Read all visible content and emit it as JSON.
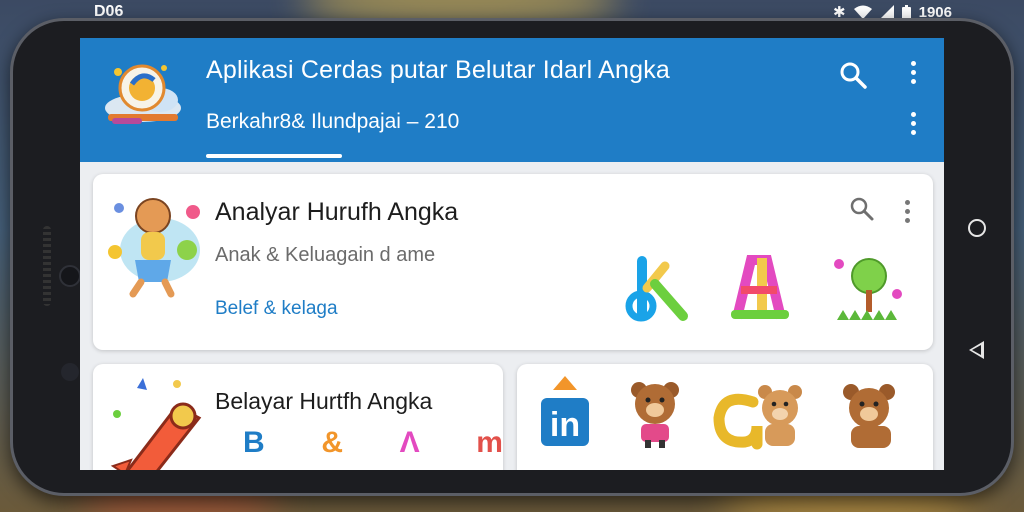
{
  "status_bar": {
    "left_text": "D06",
    "time": "1906",
    "icons": [
      "bluetooth-icon",
      "wifi-icon",
      "signal-icon",
      "battery-icon"
    ]
  },
  "app": {
    "title": "Aplikasi Cerdas putar Belutar Idarl Angka",
    "subtitle": "Berkahr8& Ilundpajai  – 210",
    "accent_color": "#1f7dc6"
  },
  "cards": [
    {
      "title": "Analyar Hurufh Angka",
      "subtitle": "Anak & Keluagain d ame",
      "link": "Belef & kelaga"
    },
    {
      "title": "Belayar Hurtfh Angka",
      "glyphs": [
        "B",
        "&",
        "Λ",
        "m"
      ]
    }
  ],
  "card3_items": [
    "in"
  ]
}
